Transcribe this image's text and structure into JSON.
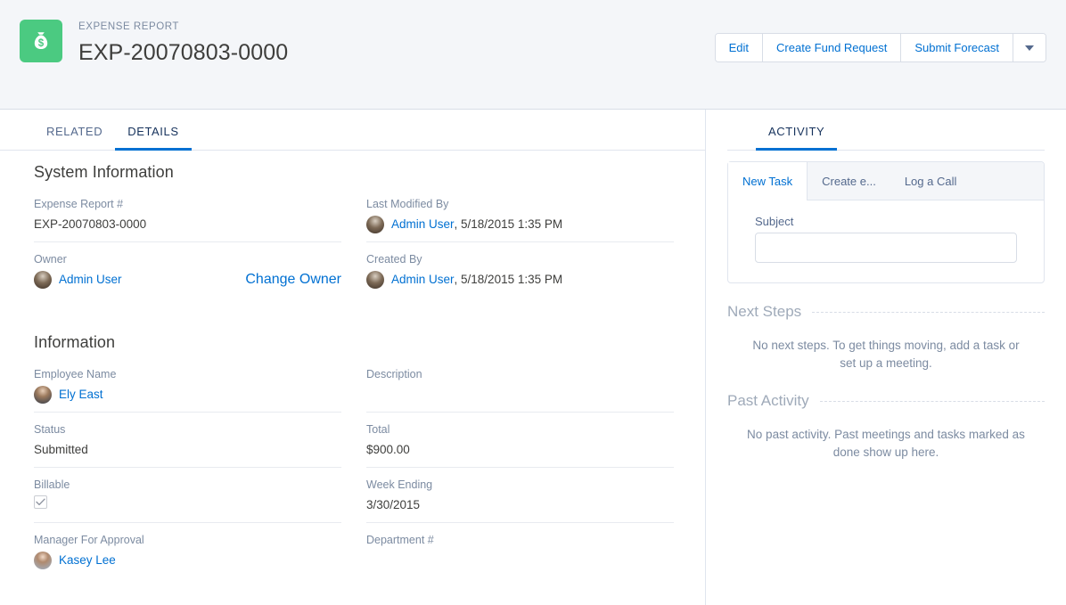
{
  "header": {
    "eyebrow": "EXPENSE REPORT",
    "title": "EXP-20070803-0000",
    "icon": "money-bag-icon",
    "icon_color": "#4bca81",
    "actions": [
      {
        "label": "Edit"
      },
      {
        "label": "Create Fund Request"
      },
      {
        "label": "Submit Forecast"
      }
    ],
    "more_actions_icon": "chevron-down-icon"
  },
  "tabs": [
    {
      "label": "RELATED",
      "active": false
    },
    {
      "label": "DETAILS",
      "active": true
    }
  ],
  "system_information": {
    "section_title": "System Information",
    "fields": {
      "expense_report_number": {
        "label": "Expense Report #",
        "value": "EXP-20070803-0000"
      },
      "owner": {
        "label": "Owner",
        "value": "Admin User",
        "action_label": "Change Owner",
        "avatar": "admin-user-avatar"
      },
      "last_modified_by": {
        "label": "Last Modified By",
        "user": "Admin User",
        "rest": ", 5/18/2015 1:35 PM",
        "avatar": "admin-user-avatar"
      },
      "created_by": {
        "label": "Created By",
        "user": "Admin User",
        "rest": ", 5/18/2015 1:35 PM",
        "avatar": "admin-user-avatar"
      }
    }
  },
  "information": {
    "section_title": "Information",
    "fields": {
      "employee_name": {
        "label": "Employee Name",
        "value": "Ely East",
        "avatar": "ely-east-avatar"
      },
      "status": {
        "label": "Status",
        "value": "Submitted"
      },
      "billable": {
        "label": "Billable",
        "checked": true
      },
      "manager_for_approval": {
        "label": "Manager For Approval",
        "value": "Kasey Lee",
        "avatar": "kasey-lee-avatar"
      },
      "description": {
        "label": "Description",
        "value": ""
      },
      "total": {
        "label": "Total",
        "value": "$900.00"
      },
      "week_ending": {
        "label": "Week Ending",
        "value": "3/30/2015"
      },
      "department_number": {
        "label": "Department #",
        "value": ""
      }
    }
  },
  "activity": {
    "tab_label": "ACTIVITY",
    "sub_tabs": [
      {
        "label": "New Task",
        "active": true
      },
      {
        "label": "Create e...",
        "active": false
      },
      {
        "label": "Log a Call",
        "active": false
      }
    ],
    "subject": {
      "label": "Subject",
      "value": "",
      "placeholder": ""
    },
    "next_steps": {
      "heading": "Next Steps",
      "empty_message": "No next steps. To get things moving, add a task or set up a meeting."
    },
    "past_activity": {
      "heading": "Past Activity",
      "empty_message": "No past activity. Past meetings and tasks marked as done show up here."
    }
  },
  "colors": {
    "accent": "#0070d2",
    "brand_green": "#4bca81",
    "label_gray": "#7c8ba1",
    "header_bg": "#f4f6f9"
  }
}
